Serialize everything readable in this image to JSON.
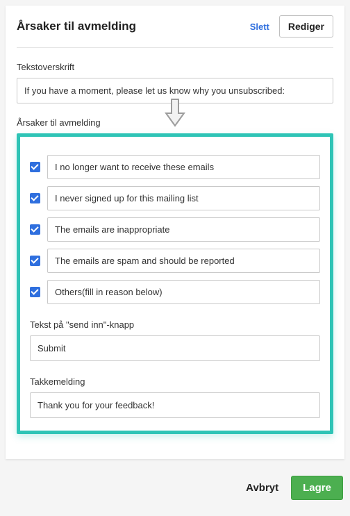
{
  "header": {
    "title": "Årsaker til avmelding",
    "delete": "Slett",
    "edit": "Rediger"
  },
  "textHeading": {
    "label": "Tekstoverskrift",
    "value": "If you have a moment, please let us know why you unsubscribed:"
  },
  "reasons": {
    "label": "Årsaker til avmelding",
    "items": [
      {
        "checked": true,
        "text": "I no longer want to receive these emails"
      },
      {
        "checked": true,
        "text": "I never signed up for this mailing list"
      },
      {
        "checked": true,
        "text": "The emails are inappropriate"
      },
      {
        "checked": true,
        "text": "The emails are spam and should be reported"
      },
      {
        "checked": true,
        "text": "Others(fill in reason below)"
      }
    ]
  },
  "submitText": {
    "label": "Tekst på \"send inn\"-knapp",
    "value": "Submit"
  },
  "thankYou": {
    "label": "Takkemelding",
    "value": "Thank you for your feedback!"
  },
  "footer": {
    "cancel": "Avbryt",
    "save": "Lagre"
  }
}
